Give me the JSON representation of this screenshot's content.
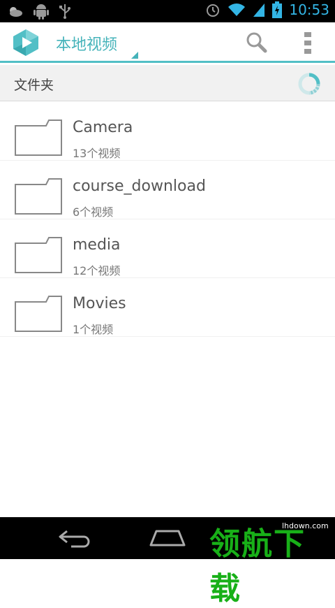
{
  "status_bar": {
    "time": "10:53",
    "icons": [
      "weather-icon",
      "android-icon",
      "usb-icon",
      "alarm-icon",
      "wifi-icon",
      "signal-icon",
      "battery-charging-icon"
    ]
  },
  "action_bar": {
    "title": "本地视频",
    "accent_color": "#45b3ba",
    "actions": [
      "search-icon",
      "overflow-menu-icon"
    ]
  },
  "section": {
    "title": "文件夹"
  },
  "folders": [
    {
      "name": "Camera",
      "count": "13个视频"
    },
    {
      "name": "course_download",
      "count": "6个视频"
    },
    {
      "name": "media",
      "count": "12个视频"
    },
    {
      "name": "Movies",
      "count": "1个视频"
    }
  ],
  "nav_bar": {
    "buttons": [
      "back-icon",
      "home-icon"
    ],
    "watermark": "领航下载",
    "watermark_url": "lhdown.com"
  }
}
